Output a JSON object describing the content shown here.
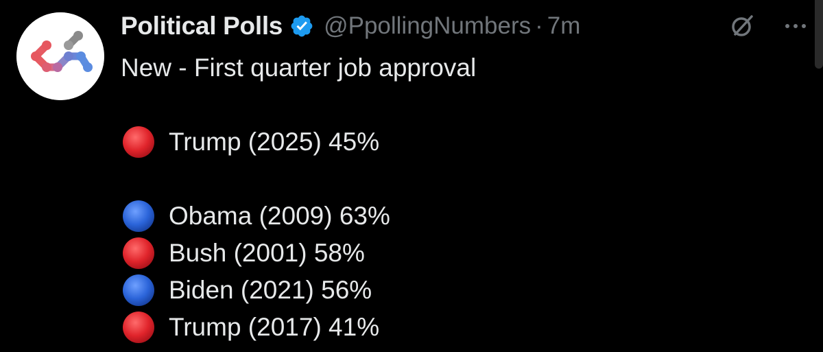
{
  "author": {
    "display_name": "Political Polls",
    "handle": "@PpollingNumbers",
    "separator": "·",
    "time": "7m",
    "avatar_icon": "network-logo-icon",
    "verified_color": "#1d9bf0"
  },
  "actions": {
    "grok_icon": "grok-icon",
    "more_icon": "more-icon"
  },
  "tweet": {
    "intro": "New - First quarter job approval",
    "items": [
      {
        "party_color": "#e0242b",
        "text": "Trump (2025) 45%"
      },
      {
        "party_color": "#2b64d9",
        "text": "Obama (2009) 63%"
      },
      {
        "party_color": "#e0242b",
        "text": "Bush (2001) 58%"
      },
      {
        "party_color": "#2b64d9",
        "text": "Biden (2021) 56%"
      },
      {
        "party_color": "#e0242b",
        "text": "Trump (2017) 41%"
      }
    ]
  },
  "colors": {
    "background": "#000000",
    "text": "#e7e9ea",
    "muted": "#71767b"
  }
}
